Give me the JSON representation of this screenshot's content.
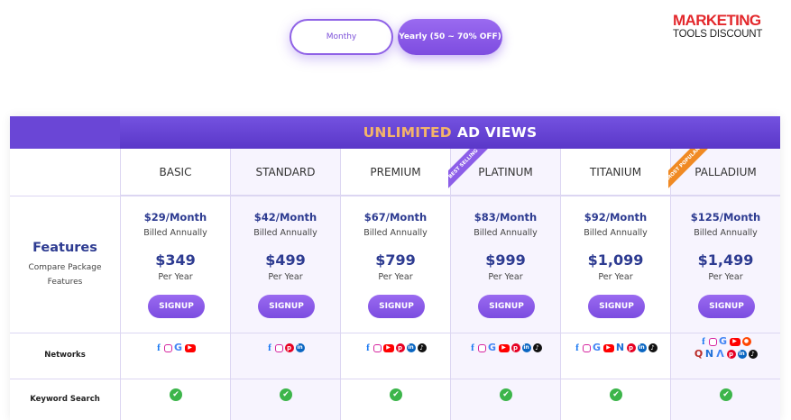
{
  "toggle": {
    "monthly": "Monthy",
    "yearly": "Yearly (50 ~ 70% OFF)"
  },
  "logo": {
    "line1": "MARKETING",
    "line2": "TOOLS DISCOUNT"
  },
  "header": {
    "accent": "UNLIMITED",
    "rest": "AD VIEWS"
  },
  "features": {
    "title": "Features",
    "subtitle_line1": "Compare Package",
    "subtitle_line2": "Features"
  },
  "rows": {
    "networks": "Networks",
    "keyword": "Keyword Search"
  },
  "ribbons": {
    "best": "BEST SELLING",
    "popular": "MOST POPULAR"
  },
  "plans": [
    {
      "name": "BASIC",
      "monthly": "$29/Month",
      "billed": "Billed Annually",
      "yearly": "$349",
      "per": "Per Year",
      "cta": "SIGNUP",
      "networks": [
        "facebook-icon",
        "instagram-icon",
        "google-icon",
        "youtube-icon"
      ]
    },
    {
      "name": "STANDARD",
      "monthly": "$42/Month",
      "billed": "Billed Annually",
      "yearly": "$499",
      "per": "Per Year",
      "cta": "SIGNUP",
      "networks": [
        "facebook-icon",
        "instagram-icon",
        "pinterest-icon",
        "linkedin-icon"
      ]
    },
    {
      "name": "PREMIUM",
      "monthly": "$67/Month",
      "billed": "Billed Annually",
      "yearly": "$799",
      "per": "Per Year",
      "cta": "SIGNUP",
      "networks": [
        "facebook-icon",
        "instagram-icon",
        "youtube-icon",
        "pinterest-icon",
        "linkedin-icon",
        "tiktok-icon"
      ]
    },
    {
      "name": "PLATINUM",
      "monthly": "$83/Month",
      "billed": "Billed Annually",
      "yearly": "$999",
      "per": "Per Year",
      "cta": "SIGNUP",
      "networks": [
        "facebook-icon",
        "instagram-icon",
        "google-icon",
        "youtube-icon",
        "pinterest-icon",
        "linkedin-icon",
        "tiktok-icon"
      ]
    },
    {
      "name": "TITANIUM",
      "monthly": "$92/Month",
      "billed": "Billed Annually",
      "yearly": "$1,099",
      "per": "Per Year",
      "cta": "SIGNUP",
      "networks": [
        "facebook-icon",
        "instagram-icon",
        "google-icon",
        "youtube-icon",
        "n-icon",
        "pinterest-icon",
        "linkedin-icon",
        "tiktok-icon"
      ]
    },
    {
      "name": "PALLADIUM",
      "monthly": "$125/Month",
      "billed": "Billed Annually",
      "yearly": "$1,499",
      "per": "Per Year",
      "cta": "SIGNUP",
      "networks": [
        "facebook-icon",
        "instagram-icon",
        "google-icon",
        "youtube-icon",
        "reddit-icon",
        "quora-icon",
        "n-icon",
        "google-ads-icon",
        "pinterest-icon",
        "linkedin-icon",
        "tiktok-icon"
      ]
    }
  ]
}
